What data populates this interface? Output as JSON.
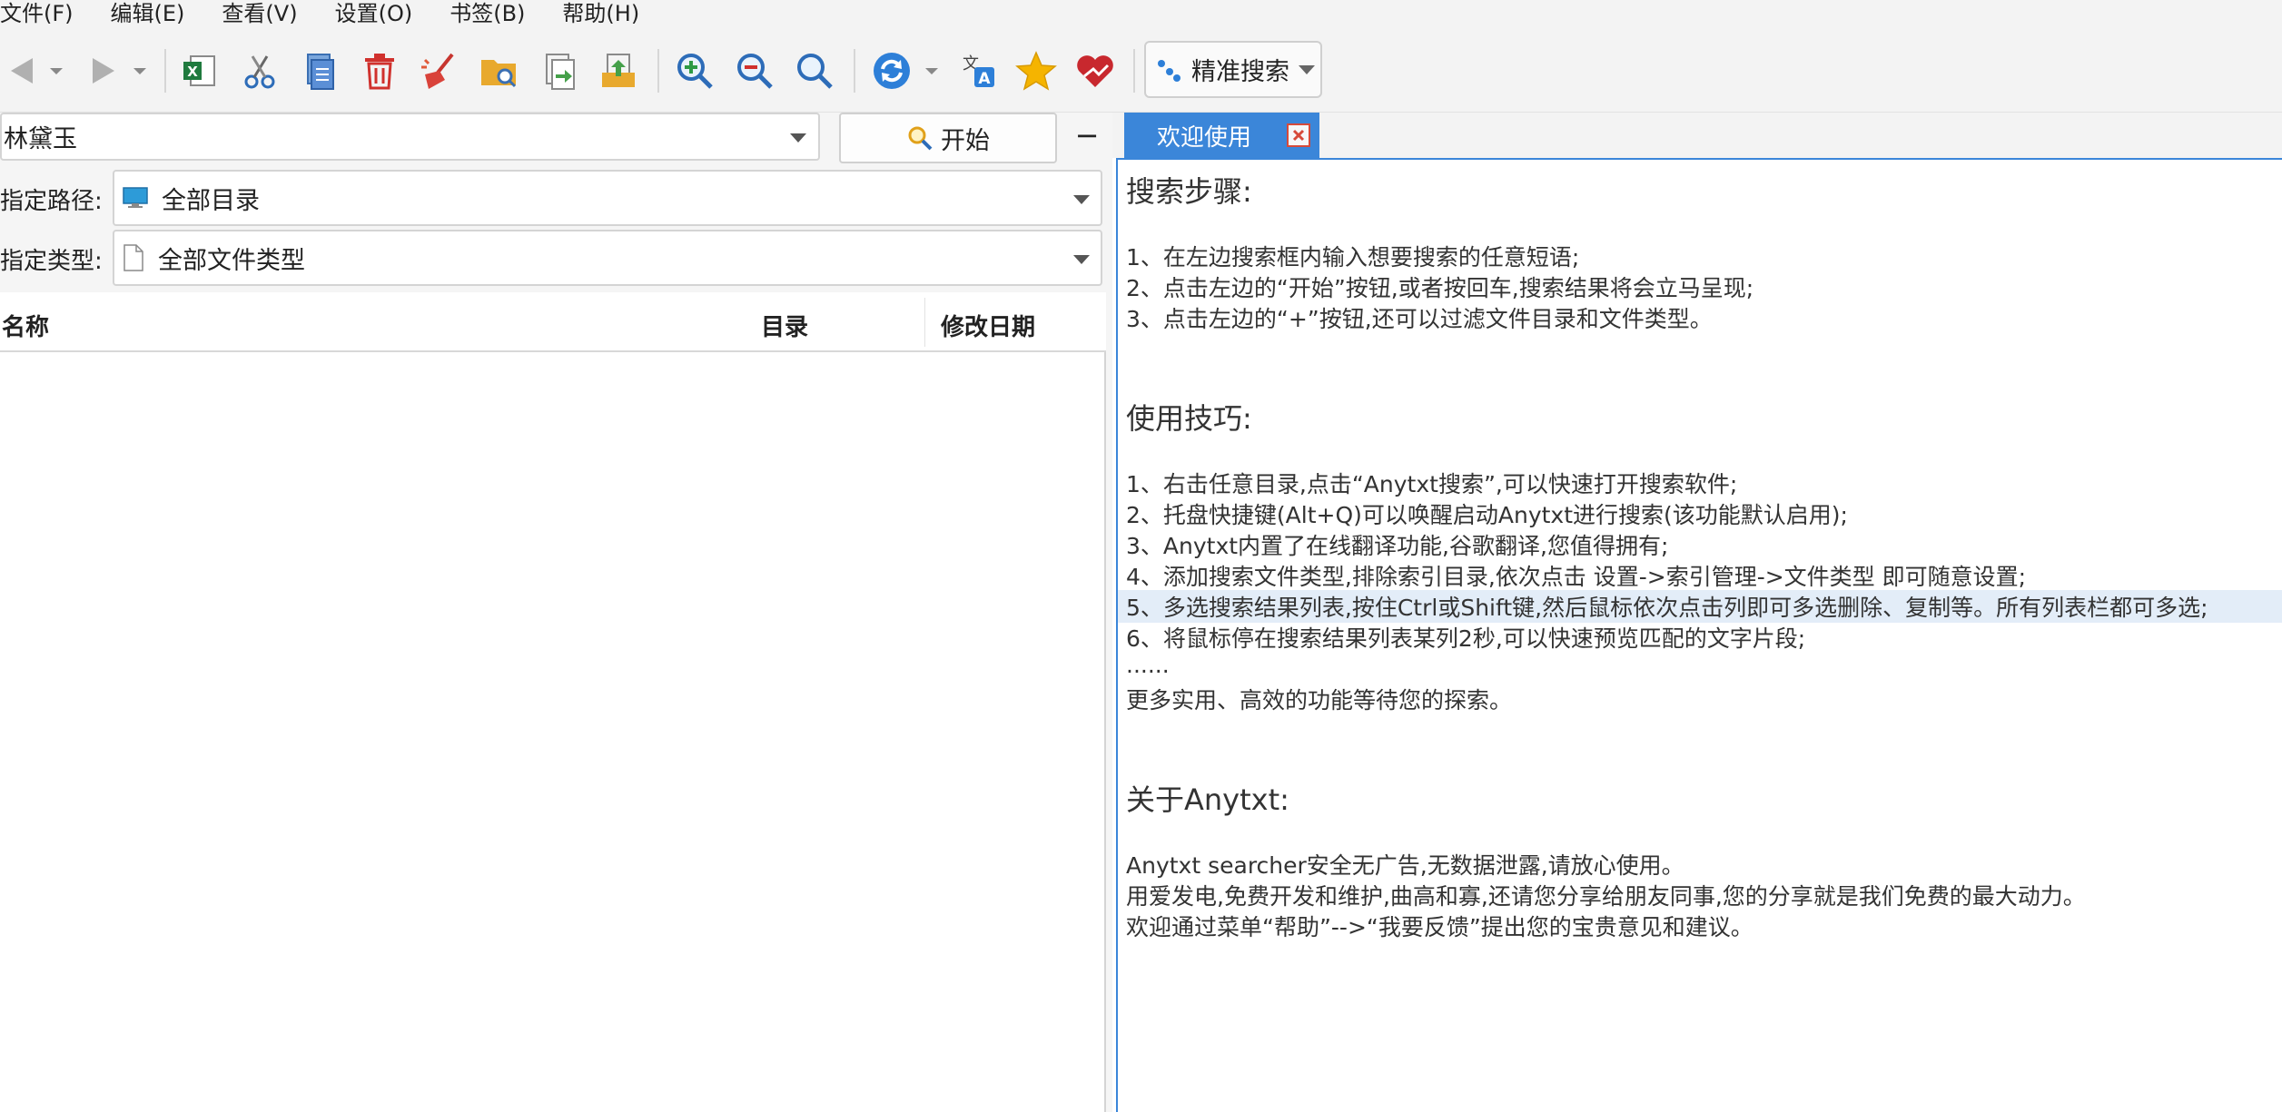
{
  "menu": [
    "文件(F)",
    "编辑(E)",
    "查看(V)",
    "设置(O)",
    "书签(B)",
    "帮助(H)"
  ],
  "toolbar": {
    "precise_search_label": "精准搜索",
    "translate_glyph_top": "文",
    "translate_glyph_bottom": "A",
    "icons": [
      "back-icon",
      "forward-icon",
      "excel-export-icon",
      "cut-icon",
      "copy-icon",
      "delete-icon",
      "clean-icon",
      "open-folder-icon",
      "move-icon",
      "export-icon",
      "zoom-in-icon",
      "zoom-out-icon",
      "zoom-reset-icon",
      "refresh-icon",
      "translate-icon",
      "bookmark-star-icon",
      "favorite-heart-icon"
    ]
  },
  "search": {
    "query": "林黛玉",
    "start_label": "开始",
    "collapse_label": "−"
  },
  "filters": {
    "path_label": "指定路径:",
    "path_value": "全部目录",
    "type_label": "指定类型:",
    "type_value": "全部文件类型"
  },
  "results": {
    "columns": [
      "名称",
      "目录",
      "修改日期"
    ]
  },
  "tab": {
    "label": "欢迎使用"
  },
  "welcome": {
    "steps_title": "搜索步骤:",
    "steps": [
      "1、在左边搜索框内输入想要搜索的任意短语;",
      "2、点击左边的“开始”按钮,或者按回车,搜索结果将会立马呈现;",
      "3、点击左边的“+”按钮,还可以过滤文件目录和文件类型。"
    ],
    "tips_title": "使用技巧:",
    "tips": [
      "1、右击任意目录,点击“Anytxt搜索”,可以快速打开搜索软件;",
      "2、托盘快捷键(Alt+Q)可以唤醒启动Anytxt进行搜索(该功能默认启用);",
      "3、Anytxt内置了在线翻译功能,谷歌翻译,您值得拥有;",
      "4、添加搜索文件类型,排除索引目录,依次点击 设置->索引管理->文件类型 即可随意设置;",
      "5、多选搜索结果列表,按住Ctrl或Shift键,然后鼠标依次点击列即可多选删除、复制等。所有列表栏都可多选;",
      "6、将鼠标停在搜索结果列表某列2秒,可以快速预览匹配的文字片段;",
      "......",
      "更多实用、高效的功能等待您的探索。"
    ],
    "about_title": "关于Anytxt:",
    "about": [
      "Anytxt searcher安全无广告,无数据泄露,请放心使用。",
      "用爱发电,免费开发和维护,曲高和寡,还请您分享给朋友同事,您的分享就是我们免费的最大动力。",
      "欢迎通过菜单“帮助”-->“我要反馈”提出您的宝贵意见和建议。"
    ]
  },
  "colors": {
    "accent": "#3b86d9",
    "close": "#d64a3a",
    "highlight": "#e3edf8"
  }
}
